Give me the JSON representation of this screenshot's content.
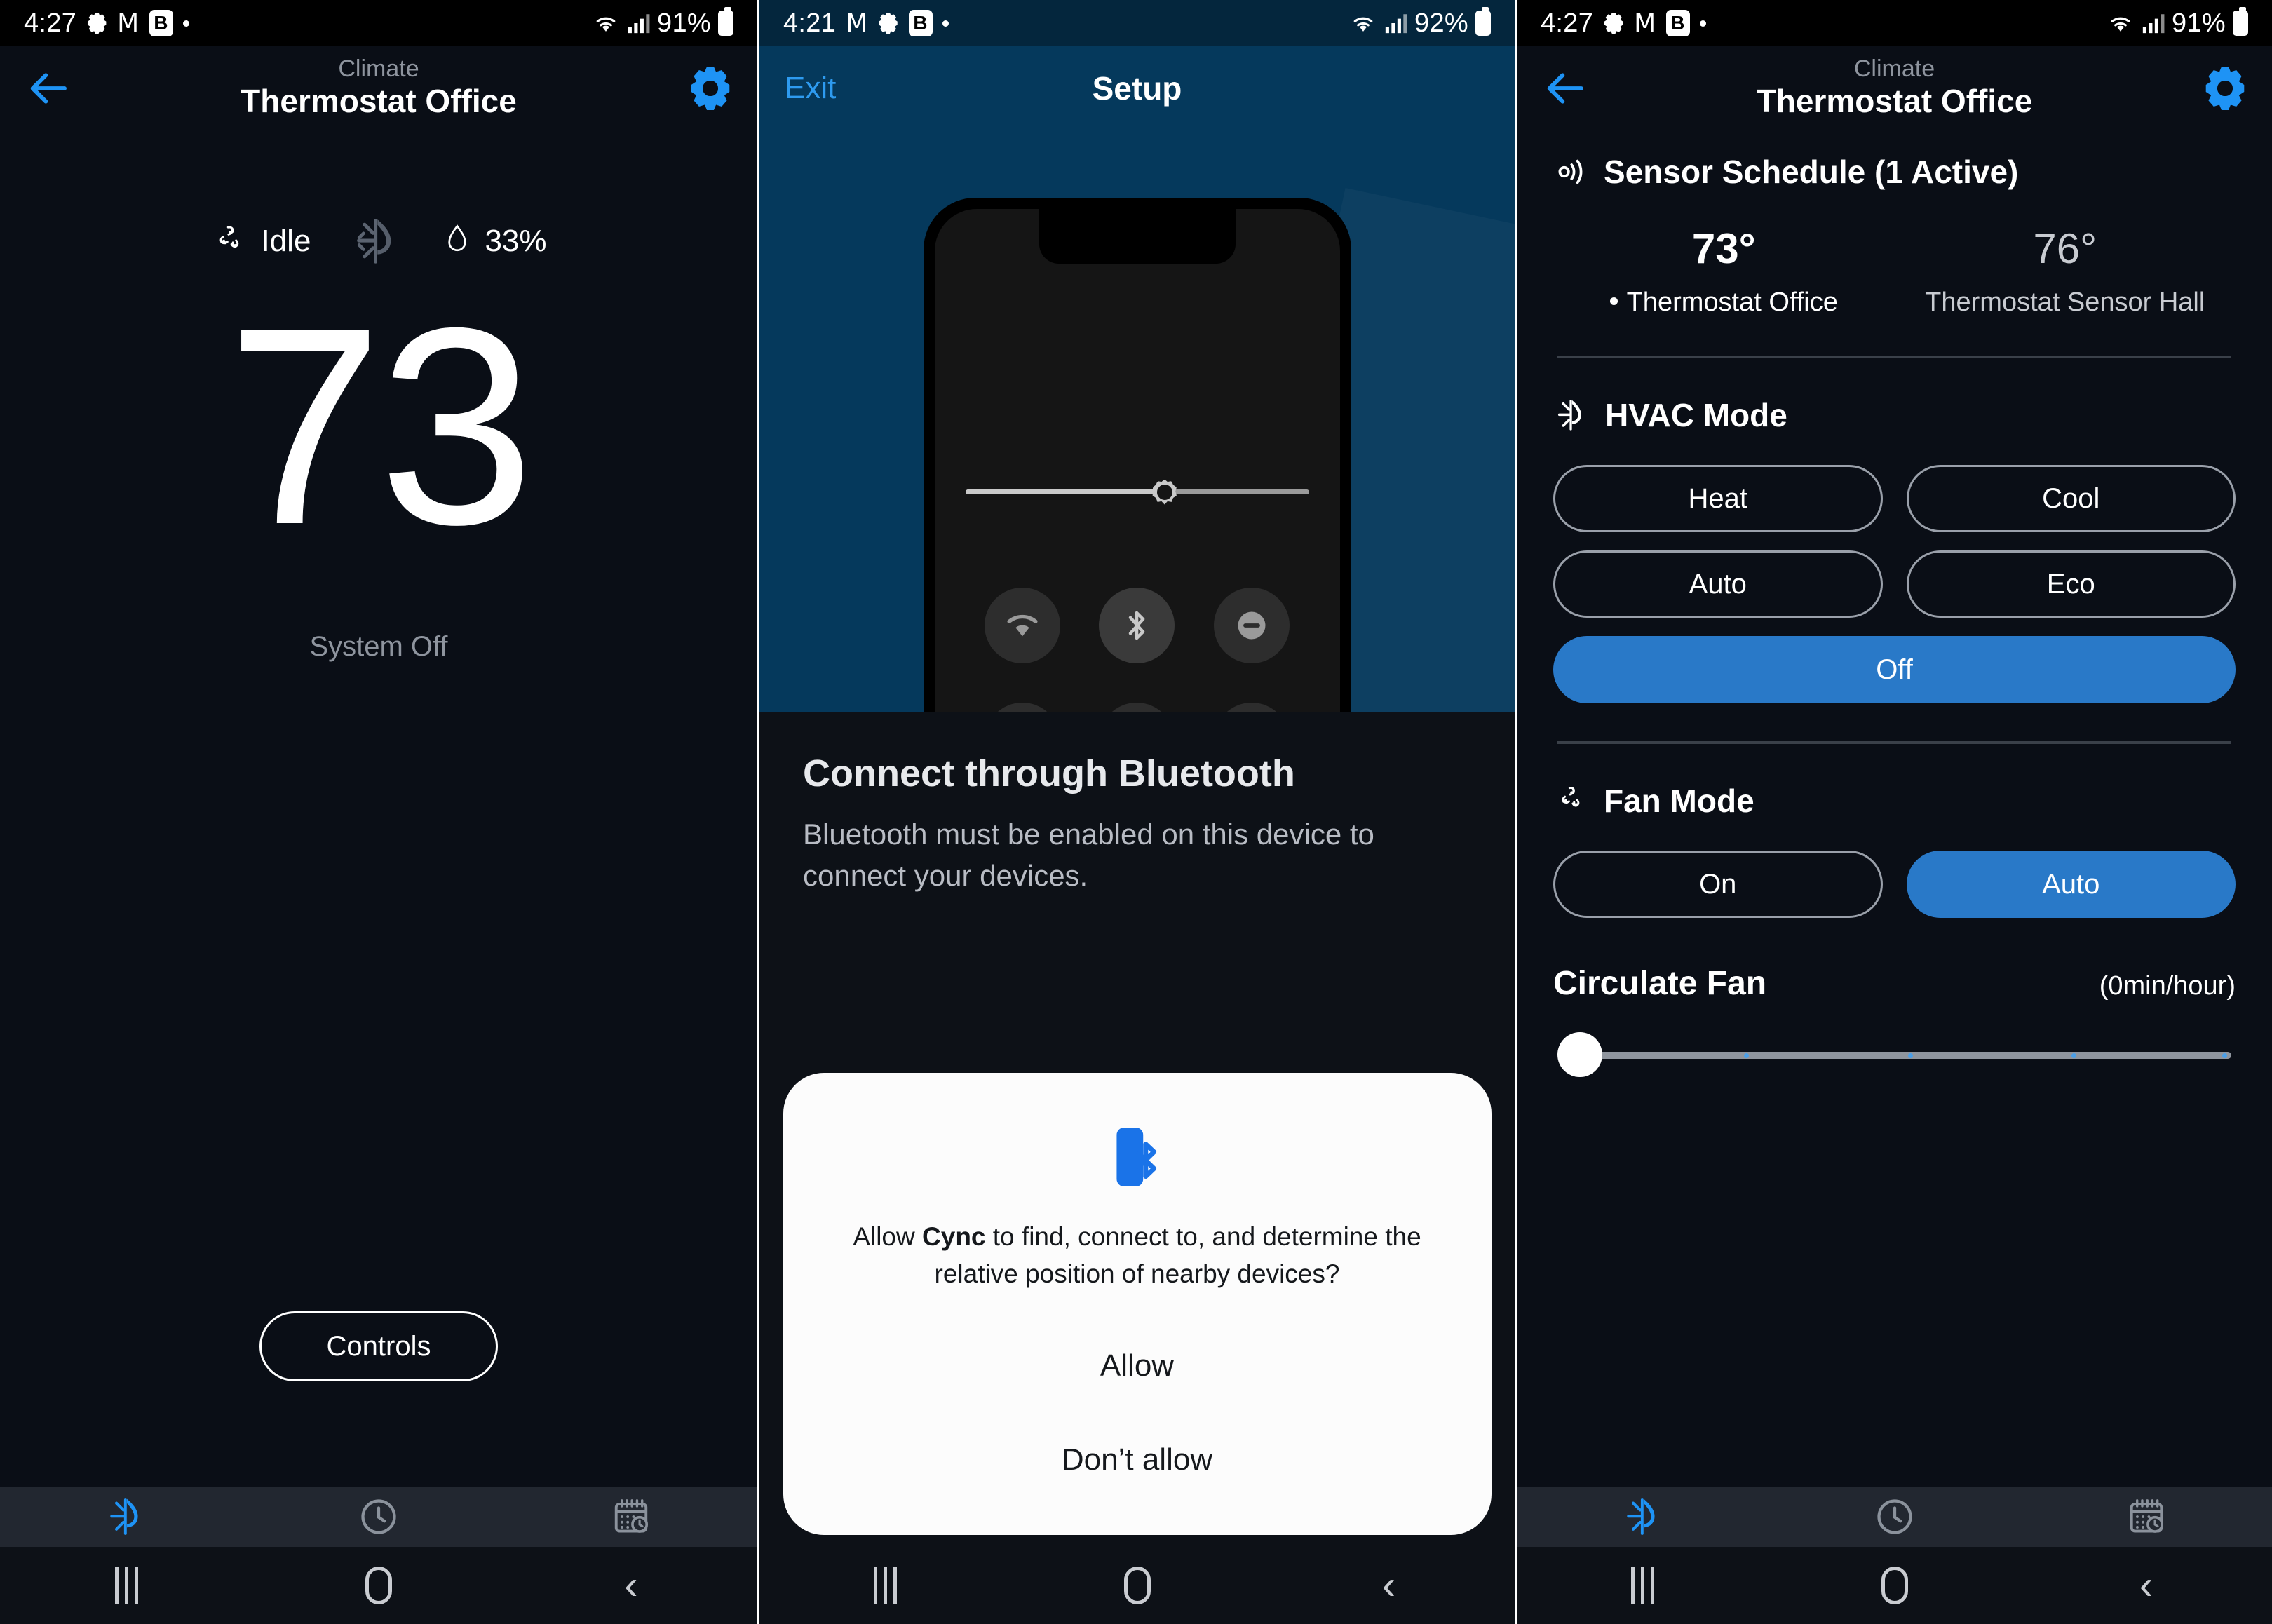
{
  "panel1": {
    "status_bar": {
      "time": "4:27",
      "battery": "91%",
      "icons": [
        "gear-icon",
        "gmail-icon",
        "bitwarden-icon",
        "dot-icon",
        "wifi-icon",
        "signal-icon",
        "battery-icon"
      ]
    },
    "header": {
      "subtitle": "Climate",
      "title": "Thermostat Office",
      "back": "back-arrow-icon",
      "settings": "gear-icon"
    },
    "status_row": {
      "fan_state": "Idle",
      "humidity": "33%",
      "hvac_icon": "hvac-mode-icon",
      "fan_icon": "fan-icon",
      "humidity_icon": "humidity-droplet-icon"
    },
    "temperature": "73",
    "system_state": "System Off",
    "controls_button": "Controls",
    "tabs": [
      {
        "name": "climate",
        "icon": "hvac-mode-icon",
        "active": true
      },
      {
        "name": "history",
        "icon": "history-clock-icon",
        "active": false
      },
      {
        "name": "schedule",
        "icon": "calendar-schedule-icon",
        "active": false
      }
    ]
  },
  "panel2": {
    "status_bar": {
      "time": "4:21",
      "battery": "92%",
      "icons": [
        "gmail-icon",
        "gear-icon",
        "bitwarden-icon",
        "dot-icon",
        "wifi-icon",
        "signal-icon",
        "battery-icon"
      ]
    },
    "header": {
      "exit": "Exit",
      "title": "Setup"
    },
    "illustration": {
      "name": "phone-quick-settings-illustration",
      "tiles": [
        "wifi-icon",
        "bluetooth-icon",
        "do-not-disturb-icon",
        "airplane-mode-icon",
        "hotspot-icon",
        "battery-saver-icon"
      ],
      "slider": "brightness-slider"
    },
    "heading": "Connect through Bluetooth",
    "body": "Bluetooth must be enabled on this device to connect your devices.",
    "dialog": {
      "icon": "bluetooth-device-icon",
      "text_before": "Allow ",
      "app_name": "Cync",
      "text_after": " to find, connect to, and determine the relative position of nearby devices?",
      "allow": "Allow",
      "deny": "Don’t allow"
    }
  },
  "panel3": {
    "status_bar": {
      "time": "4:27",
      "battery": "91%",
      "icons": [
        "gear-icon",
        "gmail-icon",
        "bitwarden-icon",
        "dot-icon",
        "wifi-icon",
        "signal-icon",
        "battery-icon"
      ]
    },
    "header": {
      "subtitle": "Climate",
      "title": "Thermostat Office",
      "back": "back-arrow-icon",
      "settings": "gear-icon"
    },
    "sensor_schedule": {
      "title": "Sensor Schedule (1 Active)",
      "icon": "sensor-broadcast-icon",
      "sensors": [
        {
          "temp": "73°",
          "name": "Thermostat Office",
          "active": true
        },
        {
          "temp": "76°",
          "name": "Thermostat Sensor Hall",
          "active": false
        }
      ]
    },
    "hvac_mode": {
      "title": "HVAC Mode",
      "icon": "hvac-mode-icon",
      "options": [
        {
          "label": "Heat",
          "selected": false
        },
        {
          "label": "Cool",
          "selected": false
        },
        {
          "label": "Auto",
          "selected": false
        },
        {
          "label": "Eco",
          "selected": false
        },
        {
          "label": "Off",
          "selected": true
        }
      ]
    },
    "fan_mode": {
      "title": "Fan Mode",
      "icon": "fan-icon",
      "options": [
        {
          "label": "On",
          "selected": false
        },
        {
          "label": "Auto",
          "selected": true
        }
      ]
    },
    "circulate_fan": {
      "label": "Circulate Fan",
      "value": "(0min/hour)",
      "slider_percent": 0
    },
    "tabs": [
      {
        "name": "climate",
        "icon": "hvac-mode-icon",
        "active": true
      },
      {
        "name": "history",
        "icon": "history-clock-icon",
        "active": false
      },
      {
        "name": "schedule",
        "icon": "calendar-schedule-icon",
        "active": false
      }
    ]
  },
  "colors": {
    "accent_blue": "#2979c8",
    "icon_blue": "#1e93f5",
    "background_dark": "#0a0e16",
    "background_blue": "#05395c",
    "tabbar": "#222730",
    "muted_text": "#8e949e"
  },
  "nav": {
    "recents": "recents-icon",
    "home": "home-icon",
    "back": "back-icon"
  }
}
